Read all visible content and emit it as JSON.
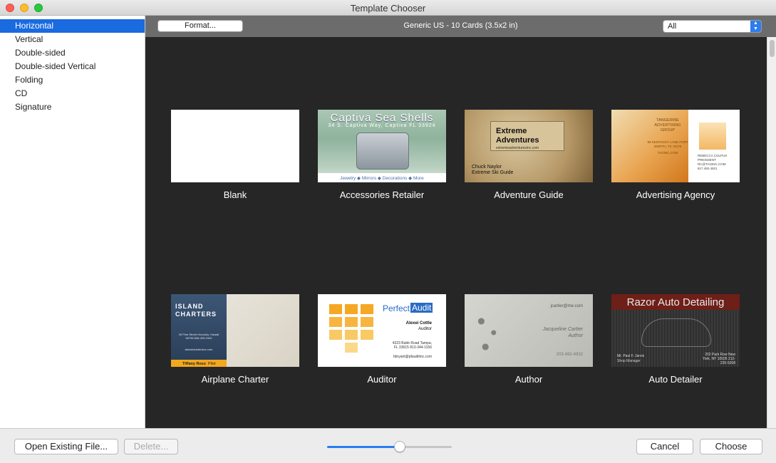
{
  "window": {
    "title": "Template Chooser"
  },
  "sidebar": {
    "items": [
      {
        "label": "Horizontal",
        "selected": true
      },
      {
        "label": "Vertical",
        "selected": false
      },
      {
        "label": "Double-sided",
        "selected": false
      },
      {
        "label": "Double-sided Vertical",
        "selected": false
      },
      {
        "label": "Folding",
        "selected": false
      },
      {
        "label": "CD",
        "selected": false
      },
      {
        "label": "Signature",
        "selected": false
      }
    ]
  },
  "toolbar": {
    "format_label": "Format...",
    "format_name": "Generic US - 10 Cards (3.5x2 in)",
    "filter_value": "All"
  },
  "templates": [
    {
      "label": "Blank"
    },
    {
      "label": "Accessories Retailer",
      "title": "Captiva Sea Shells",
      "address": "34 S. Captiva Way, Captiva FL 33924",
      "footer": "Jewelry ◆ Mirrors ◆ Decorations ◆ More"
    },
    {
      "label": "Adventure Guide",
      "heading_line1": "Extreme",
      "heading_line2": "Adventures",
      "url": "extremeadventuresinc.com",
      "name": "Chuck Naylor",
      "role": "Extreme Ski Guide"
    },
    {
      "label": "Advertising Agency",
      "company": "TANGERINE ADVERTISING GROUP",
      "address": "99 KENTUCKY LANE FORT WORTH, TX 76176",
      "site": "TAGINC.COM",
      "person": "REBECCA COLPUS",
      "title": "PRESIDENT",
      "email": "RC@TAGINC.COM",
      "phone": "817.492.4921"
    },
    {
      "label": "Airplane Charter",
      "company_line1": "ISLAND",
      "company_line2": "CHARTERS",
      "address": "30 Pine Street Honolulu, Hawaii 96796 808-403-2342",
      "site": "islandchartersinc.com",
      "person": "Tiffany Ross",
      "role": "Pilot"
    },
    {
      "label": "Auditor",
      "brand_part1": "Perfect",
      "brand_part2": "Audit",
      "person": "Alexei Cottle",
      "role": "Auditor",
      "address": "4323 Bubb Road Tampa, FL 33615 813-344-1156",
      "email": "bbryant@pfauditinc.com"
    },
    {
      "label": "Author",
      "email": "jcartier@me.com",
      "person": "Jacqueline Cartier",
      "role": "Author",
      "phone": "203-492-4932"
    },
    {
      "label": "Auto Detailer",
      "title": "Razor Auto Detailing",
      "person": "Mr. Paul F. Jarvis",
      "role": "Shop Manager",
      "address": "202 Park Row New York, NY 10026 212-235-5268"
    }
  ],
  "footer": {
    "open_label": "Open Existing File...",
    "delete_label": "Delete...",
    "cancel_label": "Cancel",
    "choose_label": "Choose",
    "zoom_level": 0.58
  },
  "colors": {
    "selection": "#1a6ae0",
    "gallery_background": "#262626",
    "accent_blue": "#2b7df0"
  }
}
